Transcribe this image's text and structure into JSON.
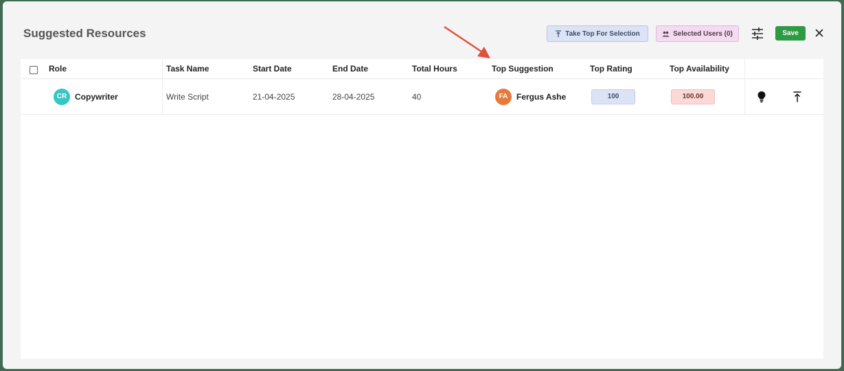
{
  "modal": {
    "title": "Suggested Resources",
    "take_top_label": "Take Top For Selection",
    "selected_users_label": "Selected Users (0)",
    "save_label": "Save"
  },
  "table": {
    "columns": [
      "Role",
      "Task Name",
      "Start Date",
      "End Date",
      "Total Hours",
      "Top Suggestion",
      "Top Rating",
      "Top Availability"
    ],
    "rows": [
      {
        "role_initials": "CR",
        "role": "Copywriter",
        "task_name": "Write Script",
        "start_date": "21-04-2025",
        "end_date": "28-04-2025",
        "total_hours": "40",
        "suggestion_initials": "FA",
        "top_suggestion": "Fergus Ashe",
        "top_rating": "100",
        "top_availability": "100.00"
      }
    ]
  },
  "colors": {
    "save": "#2e9a43",
    "role_avatar": "#36c6c4",
    "suggestion_avatar": "#e8793a",
    "rating_pill": "#dce3f5",
    "availability_pill": "#fbd9d6",
    "annotation_arrow": "#e0513a"
  },
  "icons": {
    "take_top": "align-top-icon",
    "selected_users": "users-icon",
    "filter": "sliders-icon",
    "close": "close-icon",
    "suggest": "lightbulb-icon",
    "move_top": "move-to-top-icon"
  }
}
